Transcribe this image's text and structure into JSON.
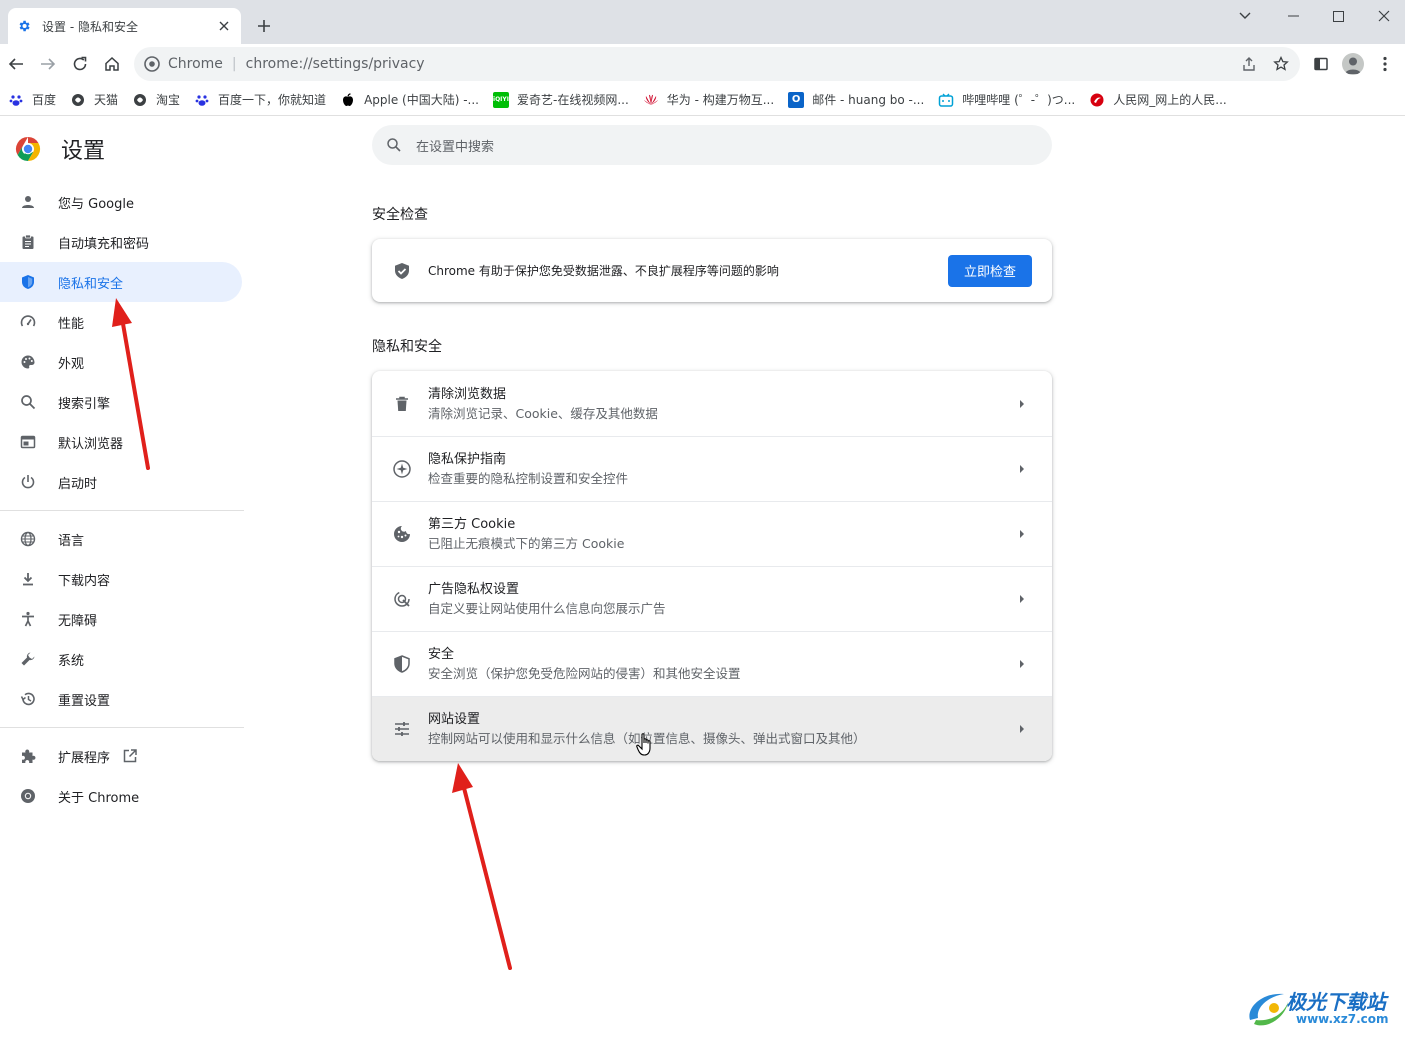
{
  "tab": {
    "title": "设置 - 隐私和安全",
    "favicon": "gear-icon"
  },
  "window_controls": [
    "chevron-down-icon",
    "minimize-icon",
    "maximize-icon",
    "close-icon"
  ],
  "omnibox": {
    "site_label": "Chrome",
    "url": "chrome://settings/privacy"
  },
  "bookmarks": [
    {
      "label": "百度",
      "icon": "baidu-paw-icon",
      "color": "#2932e1"
    },
    {
      "label": "天猫",
      "icon": "globe-icon",
      "color": "#3c4043"
    },
    {
      "label": "淘宝",
      "icon": "globe-icon",
      "color": "#3c4043"
    },
    {
      "label": "百度一下，你就知道",
      "icon": "baidu-paw-icon",
      "color": "#2932e1"
    },
    {
      "label": "Apple (中国大陆) -...",
      "icon": "apple-icon",
      "color": "#000000"
    },
    {
      "label": "爱奇艺-在线视频网...",
      "icon": "iqiyi-icon",
      "color": "#00be06"
    },
    {
      "label": "华为 - 构建万物互...",
      "icon": "huawei-icon",
      "color": "#cf0a2c"
    },
    {
      "label": "邮件 - huang bo -...",
      "icon": "outlook-icon",
      "color": "#0a64c8"
    },
    {
      "label": "哔哩哔哩 (゜-゜)つ...",
      "icon": "bilibili-icon",
      "color": "#00a1d6"
    },
    {
      "label": "人民网_网上的人民...",
      "icon": "people-daily-icon",
      "color": "#d7000f"
    }
  ],
  "settings": {
    "title": "设置",
    "search_placeholder": "在设置中搜索",
    "nav_group_1": [
      {
        "label": "您与 Google",
        "icon": "person-icon"
      },
      {
        "label": "自动填充和密码",
        "icon": "clipboard-icon"
      },
      {
        "label": "隐私和安全",
        "icon": "shield-icon",
        "active": true
      },
      {
        "label": "性能",
        "icon": "speedometer-icon"
      },
      {
        "label": "外观",
        "icon": "palette-icon"
      },
      {
        "label": "搜索引擎",
        "icon": "search-icon"
      },
      {
        "label": "默认浏览器",
        "icon": "browser-window-icon"
      },
      {
        "label": "启动时",
        "icon": "power-icon"
      }
    ],
    "nav_group_2": [
      {
        "label": "语言",
        "icon": "globe-icon"
      },
      {
        "label": "下载内容",
        "icon": "download-icon"
      },
      {
        "label": "无障碍",
        "icon": "accessibility-icon"
      },
      {
        "label": "系统",
        "icon": "wrench-icon"
      },
      {
        "label": "重置设置",
        "icon": "history-icon"
      }
    ],
    "nav_group_3": [
      {
        "label": "扩展程序",
        "icon": "puzzle-icon",
        "external": true
      },
      {
        "label": "关于 Chrome",
        "icon": "chrome-icon"
      }
    ]
  },
  "safety_check": {
    "section_title": "安全检查",
    "text": "Chrome 有助于保护您免受数据泄露、不良扩展程序等问题的影响",
    "button_label": "立即检查"
  },
  "privacy": {
    "section_title": "隐私和安全",
    "rows": [
      {
        "title": "清除浏览数据",
        "subtitle": "清除浏览记录、Cookie、缓存及其他数据",
        "icon": "trash-icon"
      },
      {
        "title": "隐私保护指南",
        "subtitle": "检查重要的隐私控制设置和安全控件",
        "icon": "compass-icon"
      },
      {
        "title": "第三方 Cookie",
        "subtitle": "已阻止无痕模式下的第三方 Cookie",
        "icon": "cookie-icon"
      },
      {
        "title": "广告隐私权设置",
        "subtitle": "自定义要让网站使用什么信息向您展示广告",
        "icon": "ad-privacy-icon"
      },
      {
        "title": "安全",
        "subtitle": "安全浏览（保护您免受危险网站的侵害）和其他安全设置",
        "icon": "security-shield-icon"
      },
      {
        "title": "网站设置",
        "subtitle": "控制网站可以使用和显示什么信息（如位置信息、摄像头、弹出式窗口及其他）",
        "icon": "sliders-icon",
        "hover": true
      }
    ]
  },
  "watermark": {
    "text": "极光下载站",
    "url": "www.xz7.com"
  },
  "colors": {
    "accent": "#1a73e8",
    "active_bg": "#e8f0fe",
    "annotation_arrow": "#e0201b"
  }
}
